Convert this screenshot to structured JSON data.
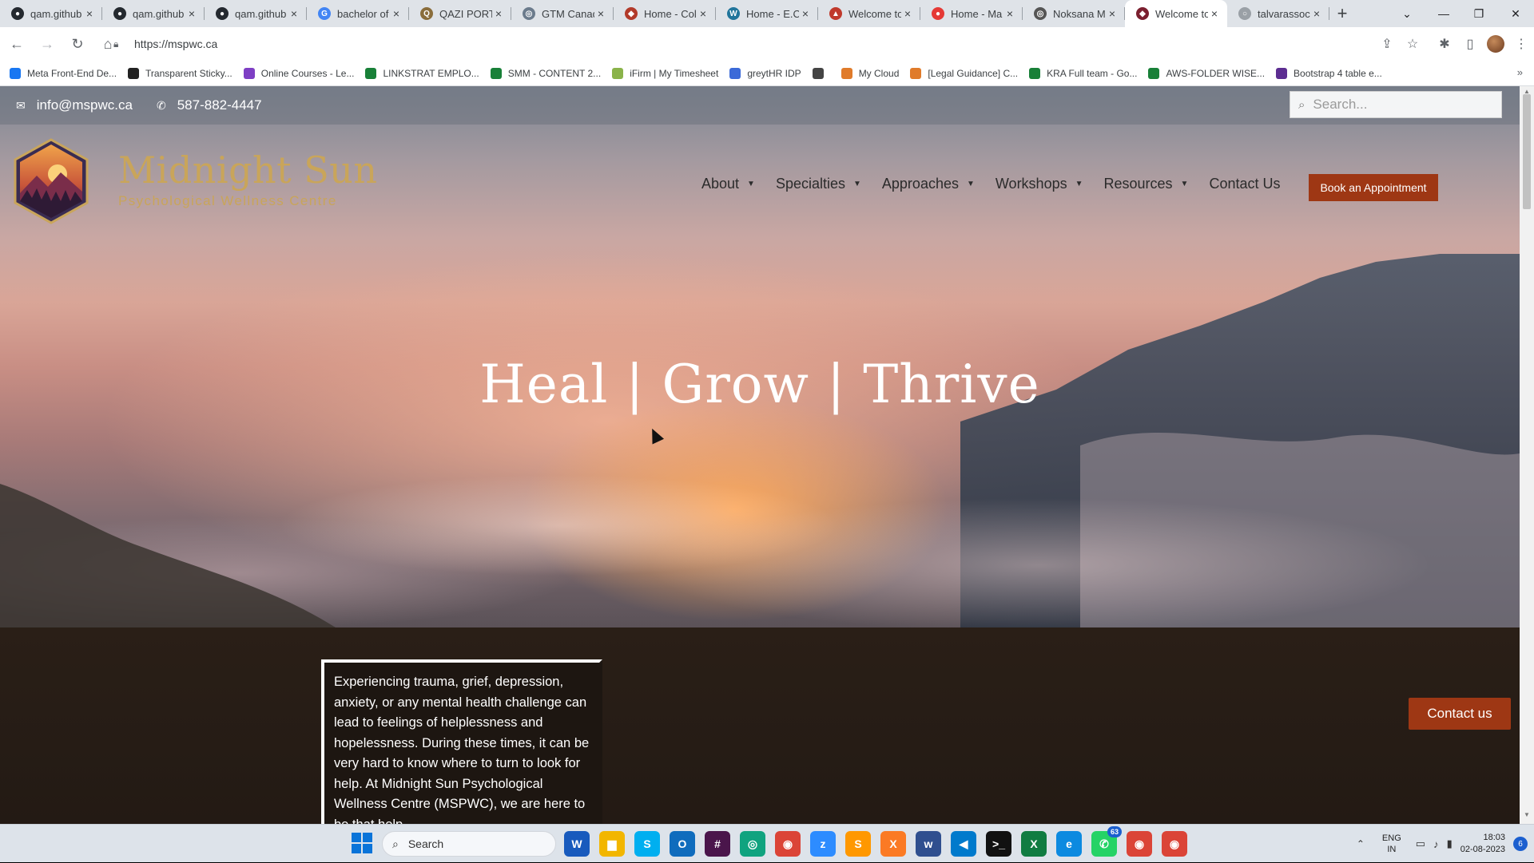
{
  "browser": {
    "tabs": [
      {
        "title": "qam.github",
        "fav_color": "#24292f",
        "fav_glyph": "●"
      },
      {
        "title": "qam.github",
        "fav_color": "#24292f",
        "fav_glyph": "●"
      },
      {
        "title": "qam.github",
        "fav_color": "#24292f",
        "fav_glyph": "●"
      },
      {
        "title": "bachelor of",
        "fav_color": "#4285f4",
        "fav_glyph": "G"
      },
      {
        "title": "QAZI PORT",
        "fav_color": "#8a6d3b",
        "fav_glyph": "Q"
      },
      {
        "title": "GTM Canad",
        "fav_color": "#6b7b8c",
        "fav_glyph": "◎"
      },
      {
        "title": "Home - Col",
        "fav_color": "#b23a2a",
        "fav_glyph": "◆"
      },
      {
        "title": "Home - E.C",
        "fav_color": "#21759b",
        "fav_glyph": "W"
      },
      {
        "title": "Welcome to",
        "fav_color": "#c0392b",
        "fav_glyph": "▲"
      },
      {
        "title": "Home - Ma",
        "fav_color": "#e53935",
        "fav_glyph": "●"
      },
      {
        "title": "Noksana M",
        "fav_color": "#555555",
        "fav_glyph": "◎"
      },
      {
        "title": "Welcome to",
        "fav_color": "#7b1f2f",
        "fav_glyph": "◆"
      },
      {
        "title": "talvarassoc",
        "fav_color": "#9aa0a6",
        "fav_glyph": "○"
      }
    ],
    "active_tab_index": 11,
    "new_tab": "+",
    "url": "https://mspwc.ca",
    "bookmarks": [
      {
        "label": "Meta Front-End De...",
        "color": "#1877f2"
      },
      {
        "label": "Transparent Sticky...",
        "color": "#222222"
      },
      {
        "label": "Online Courses - Le...",
        "color": "#7e3fc4"
      },
      {
        "label": "LINKSTRAT EMPLO...",
        "color": "#188038"
      },
      {
        "label": "SMM - CONTENT 2...",
        "color": "#188038"
      },
      {
        "label": "iFirm | My Timesheet",
        "color": "#8ab34a"
      },
      {
        "label": "greytHR IDP",
        "color": "#3b6ad8"
      },
      {
        "label": "",
        "color": "#444444"
      },
      {
        "label": "My Cloud",
        "color": "#e07b2a"
      },
      {
        "label": "[Legal Guidance] C...",
        "color": "#e07b2a"
      },
      {
        "label": "KRA Full team - Go...",
        "color": "#188038"
      },
      {
        "label": "AWS-FOLDER WISE...",
        "color": "#188038"
      },
      {
        "label": "Bootstrap 4 table e...",
        "color": "#5c2d91"
      }
    ]
  },
  "site": {
    "topbar": {
      "email": "info@mspwc.ca",
      "phone": "587-882-4447",
      "search_placeholder": "Search..."
    },
    "brand": {
      "name": "Midnight Sun",
      "tagline": "Psychological Wellness Centre"
    },
    "nav": [
      {
        "label": "About",
        "has_dropdown": true
      },
      {
        "label": "Specialties",
        "has_dropdown": true
      },
      {
        "label": "Approaches",
        "has_dropdown": true
      },
      {
        "label": "Workshops",
        "has_dropdown": true
      },
      {
        "label": "Resources",
        "has_dropdown": true
      },
      {
        "label": "Contact Us",
        "has_dropdown": false
      }
    ],
    "cta_button": "Book an Appointment",
    "hero_title": "Heal | Grow | Thrive",
    "intro_text": "Experiencing trauma, grief, depression, anxiety, or any mental health challenge can lead to feelings of helplessness and hopelessness. During these times, it can be very hard to know where to turn to look for help. At Midnight Sun Psychological Wellness Centre (MSPWC), we are here to be that help.",
    "contact_float": "Contact us",
    "accent_color": "#9e3714",
    "gold_color": "#c9a55a"
  },
  "taskbar": {
    "search_label": "Search",
    "apps": [
      {
        "name": "word",
        "glyph": "W",
        "color": "#185abd"
      },
      {
        "name": "file-explorer",
        "glyph": "▆",
        "color": "#f2b600"
      },
      {
        "name": "skype",
        "glyph": "S",
        "color": "#00aff0"
      },
      {
        "name": "outlook",
        "glyph": "O",
        "color": "#0f6cbd"
      },
      {
        "name": "slack",
        "glyph": "#",
        "color": "#4a154b"
      },
      {
        "name": "chatgpt",
        "glyph": "◎",
        "color": "#10a37f"
      },
      {
        "name": "chrome",
        "glyph": "◉",
        "color": "#db4437"
      },
      {
        "name": "zoom",
        "glyph": "z",
        "color": "#2d8cff"
      },
      {
        "name": "sublime",
        "glyph": "S",
        "color": "#ff9800"
      },
      {
        "name": "xampp",
        "glyph": "X",
        "color": "#fb7a24"
      },
      {
        "name": "app-w",
        "glyph": "w",
        "color": "#2f4f8f"
      },
      {
        "name": "vscode",
        "glyph": "◀",
        "color": "#007acc"
      },
      {
        "name": "terminal",
        "glyph": ">_",
        "color": "#111111"
      },
      {
        "name": "excel",
        "glyph": "X",
        "color": "#107c41"
      },
      {
        "name": "edge",
        "glyph": "e",
        "color": "#0c8ae0"
      },
      {
        "name": "whatsapp",
        "glyph": "✆",
        "color": "#25d366",
        "badge": "63"
      },
      {
        "name": "chrome-profile-1",
        "glyph": "◉",
        "color": "#db4437"
      },
      {
        "name": "chrome-profile-2",
        "glyph": "◉",
        "color": "#db4437"
      }
    ],
    "lang_line1": "ENG",
    "lang_line2": "IN",
    "time": "18:03",
    "date": "02-08-2023",
    "notifications": "6"
  }
}
